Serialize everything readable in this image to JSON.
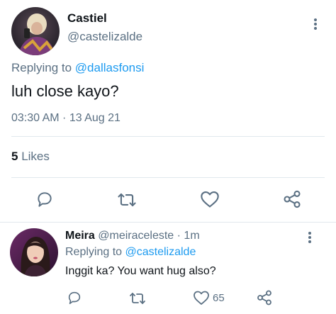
{
  "main_tweet": {
    "author_name": "Castiel",
    "author_handle": "@castelizalde",
    "replying_label": "Replying to",
    "replying_to": "@dallasfonsi",
    "text": "luh close kayo?",
    "timestamp": "03:30 AM · 13 Aug 21",
    "likes_count": "5",
    "likes_label": "Likes"
  },
  "reply_tweet": {
    "author_name": "Meira",
    "author_handle": "@meiraceleste",
    "time_ago": "· 1m",
    "replying_label": "Replying to",
    "replying_to": "@castelizalde",
    "text": "Inggit ka? You want hug also?",
    "like_count": "65"
  },
  "icons": {
    "reply": "reply-icon",
    "retweet": "retweet-icon",
    "like": "heart-icon",
    "share": "share-icon",
    "more": "more-vertical-icon"
  },
  "colors": {
    "accent": "#1d9bf0",
    "muted": "#5b7083",
    "text": "#0f1419",
    "divider": "#e1e8ed"
  }
}
